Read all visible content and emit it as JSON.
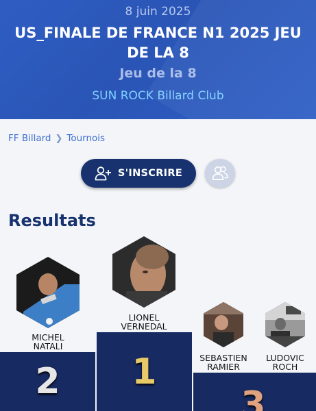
{
  "header": {
    "date": "8 juin 2025",
    "title": "US_FINALE DE FRANCE N1 2025 JEU DE LA 8",
    "game": "Jeu de la 8",
    "club": "SUN ROCK Billard Club"
  },
  "breadcrumb": {
    "items": [
      "FF Billard",
      "Tournois"
    ],
    "separator": "❯"
  },
  "actions": {
    "register_label": "S'INSCRIRE",
    "register_icon": "add-user-icon",
    "follow_icon": "users-icon"
  },
  "results": {
    "title": "Resultats",
    "podium": [
      {
        "rank": "1",
        "first_name": "LIONEL",
        "last_name": "VERNEDAL"
      },
      {
        "rank": "2",
        "first_name": "MICHEL",
        "last_name": "NATALI"
      },
      {
        "rank": "3",
        "first_name": "SEBASTIEN",
        "last_name": "RAMIER"
      },
      {
        "rank": "3",
        "first_name": "LUDOVIC",
        "last_name": "ROCH"
      }
    ]
  },
  "colors": {
    "header_bg": "#2e5dc2",
    "navy": "#17326e",
    "link": "#3d6fcf",
    "club": "#7fd0ff",
    "gold": "#e8c96a",
    "silver": "#e6e6e6",
    "bronze": "#e0a27e"
  }
}
